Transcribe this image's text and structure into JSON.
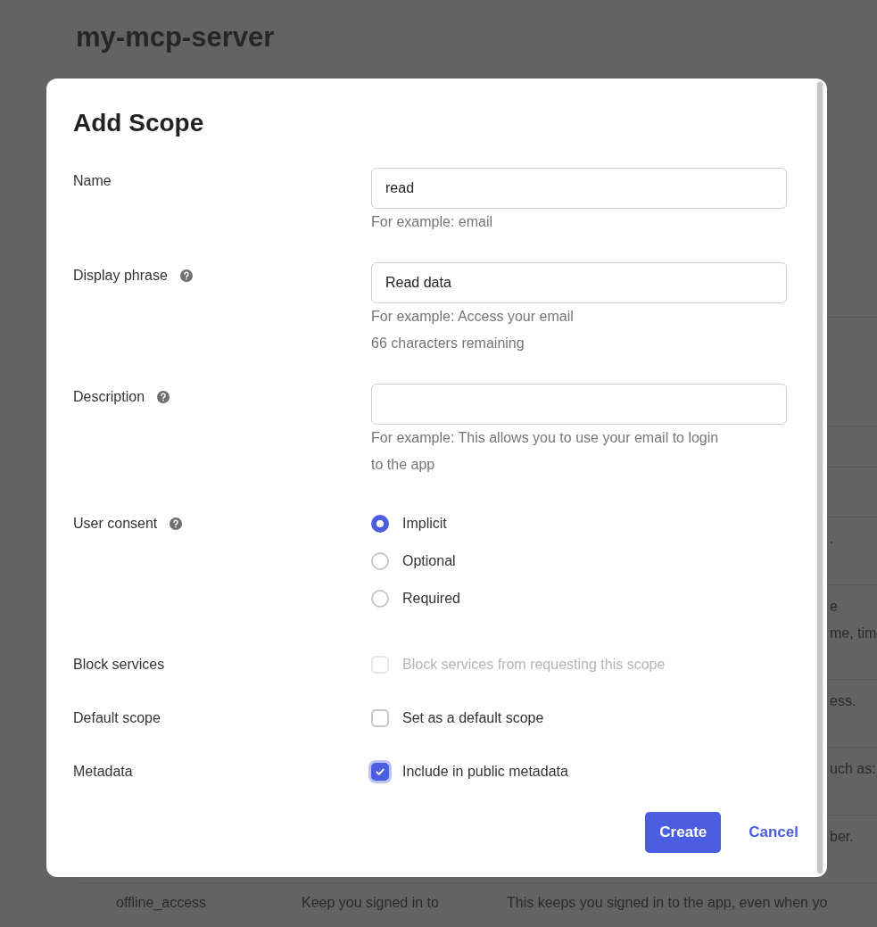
{
  "page": {
    "title": "my-mcp-server",
    "table_rows": [
      {
        "lines": [
          "."
        ]
      },
      {
        "lines": [
          "e",
          "me, tim"
        ]
      },
      {
        "lines": [
          "ess."
        ]
      },
      {
        "lines": [
          "uch as:"
        ]
      },
      {
        "lines": [
          "ber."
        ]
      }
    ],
    "last_row": [
      [
        "offline_access"
      ],
      [
        "Keep you signed in to"
      ],
      [
        "This keeps you signed in to the app, even when yo"
      ]
    ]
  },
  "modal": {
    "title": "Add Scope",
    "fields": [
      {
        "kind": "text",
        "label": "Name",
        "help": false,
        "value": "read",
        "hints": [
          "For example: email"
        ]
      },
      {
        "kind": "text",
        "label": "Display phrase",
        "help": true,
        "value": "Read data",
        "hints": [
          "For example: Access your email",
          "66 characters remaining"
        ]
      },
      {
        "kind": "text",
        "label": "Description",
        "help": true,
        "hints": [
          "For example: This allows you to use your email to login to the app"
        ]
      },
      {
        "kind": "radio",
        "label": "User consent",
        "help": true,
        "options": [
          {
            "label": "Implicit",
            "selected": true
          },
          {
            "label": "Optional",
            "selected": false
          },
          {
            "label": "Required",
            "selected": false
          }
        ]
      },
      {
        "kind": "checkbox",
        "label": "Block services",
        "help": false,
        "option": "Block services from requesting this scope",
        "checked": false,
        "disabled": true
      },
      {
        "kind": "checkbox",
        "label": "Default scope",
        "help": false,
        "option": "Set as a default scope",
        "checked": false,
        "disabled": false
      },
      {
        "kind": "checkbox",
        "label": "Metadata",
        "help": false,
        "option": "Include in public metadata",
        "checked": true,
        "disabled": false
      }
    ],
    "buttons": [
      {
        "label": "Create",
        "kind": "primary"
      },
      {
        "label": "Cancel",
        "kind": "link"
      }
    ]
  }
}
